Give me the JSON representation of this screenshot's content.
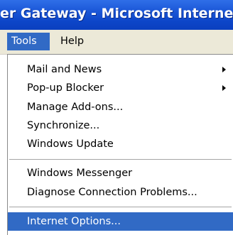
{
  "window": {
    "title": "er Gateway - Microsoft Internet E"
  },
  "menubar": {
    "items": [
      {
        "label": "Tools",
        "active": true
      },
      {
        "label": "Help",
        "active": false
      }
    ]
  },
  "tools_menu": {
    "items": [
      {
        "label": "Mail and News",
        "submenu": true
      },
      {
        "label": "Pop-up Blocker",
        "submenu": true
      },
      {
        "label": "Manage Add-ons..."
      },
      {
        "label": "Synchronize..."
      },
      {
        "label": "Windows Update"
      },
      {
        "label": "Windows Messenger"
      },
      {
        "label": "Diagnose Connection Problems..."
      },
      {
        "label": "Internet Options...",
        "highlighted": true
      }
    ]
  },
  "colors": {
    "title_bar": "#0a3fbf",
    "highlight": "#316ac5",
    "menu_bar": "#ece9d8"
  },
  "icons": {
    "submenu_indicator": "submenu-arrow-icon"
  }
}
